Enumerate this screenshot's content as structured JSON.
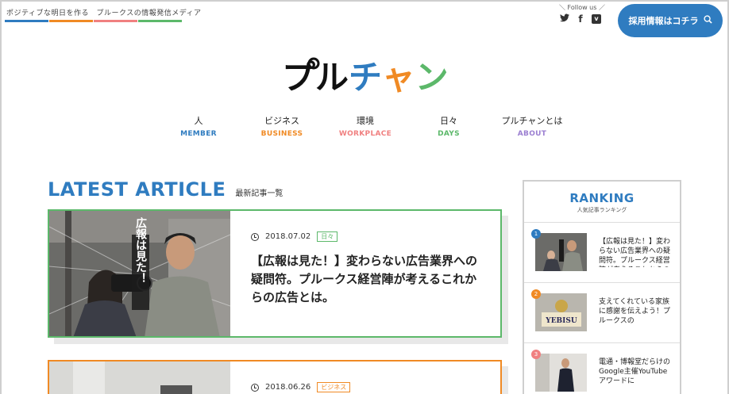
{
  "header": {
    "tagline": "ポジティブな明日を作る　プルークスの情報発信メディア",
    "bar_colors": [
      "#2f7cc0",
      "#f08a24",
      "#f08080",
      "#5cb86a"
    ],
    "follow_label": "＼ Follow us ／",
    "social": [
      {
        "icon": "twitter-icon",
        "glyph": "🐦"
      },
      {
        "icon": "facebook-icon",
        "glyph": "f"
      },
      {
        "icon": "vimeo-icon",
        "glyph": "v"
      }
    ],
    "recruit_label": "採用情報はコチラ",
    "logo_text": "プルチャン",
    "logo_colors": [
      "#111111",
      "#111111",
      "#2f7cc0",
      "#f08a24",
      "#5cb86a"
    ]
  },
  "nav": [
    {
      "jp": "人",
      "en": "MEMBER",
      "color": "#2f7cc0"
    },
    {
      "jp": "ビジネス",
      "en": "BUSINESS",
      "color": "#f08a24"
    },
    {
      "jp": "環境",
      "en": "WORKPLACE",
      "color": "#f08080"
    },
    {
      "jp": "日々",
      "en": "DAYS",
      "color": "#5cb86a"
    },
    {
      "jp": "プルチャンとは",
      "en": "ABOUT",
      "color": "#9b7fd1"
    }
  ],
  "latest": {
    "title_en": "LATEST ARTICLE",
    "title_jp": "最新記事一覧"
  },
  "articles": [
    {
      "date": "2018.07.02",
      "tag": "日々",
      "tag_color": "#5cb86a",
      "title": "【広報は見た！】変わらない広告業界への疑問符。プルークス経営陣が考えるこれからの広告とは。",
      "thumb_caption": "広報は見た！"
    },
    {
      "date": "2018.06.26",
      "tag": "ビジネス",
      "tag_color": "#f08a24",
      "title": ""
    }
  ],
  "ranking": {
    "title_en": "RANKING",
    "title_jp": "人気記事ランキング",
    "items": [
      {
        "num": "1",
        "color": "#2f7cc0",
        "text": "【広報は見た！】変わらない広告業界への疑問符。プルークス経営陣が考えるこれからの広告とは。"
      },
      {
        "num": "2",
        "color": "#f08a24",
        "text": "支えてくれている家族に感謝を伝えよう！プルークスの"
      },
      {
        "num": "3",
        "color": "#f08080",
        "text": "電通・博報堂だらけのGoogle主催YouTubeアワードに"
      }
    ],
    "item2_thumb_text": "YEBISU"
  }
}
